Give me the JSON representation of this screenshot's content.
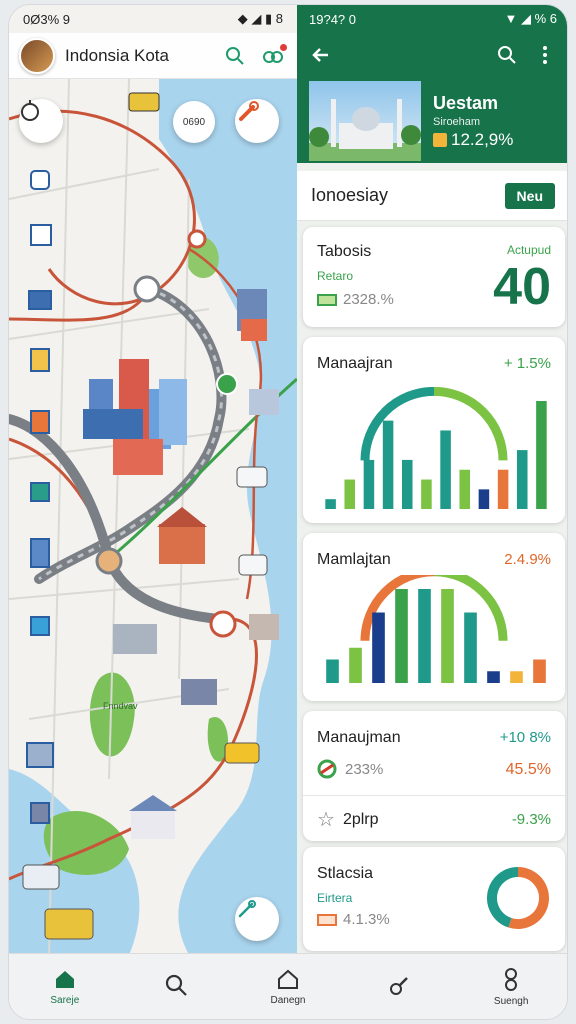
{
  "status_left": {
    "time": "0Ø3% 9",
    "icons": "◆ ◢ ▮ 8"
  },
  "status_right": {
    "time": "19?4? 0",
    "icons": "▼ ◢ % 6"
  },
  "app": {
    "title": "Indonsia Kota"
  },
  "map": {
    "button_label": "0690",
    "region_label": "Fnndvav"
  },
  "detail": {
    "hero_title": "Uestam",
    "hero_subtitle": "Siroeham",
    "hero_value": "12.2,9%",
    "section_label": "Ionoesiay",
    "new_button": "Neu"
  },
  "cards": {
    "c1": {
      "title": "Tabosis",
      "right_label": "Actupud",
      "sub_label": "Retaro",
      "value": "2328.%",
      "big": "40"
    },
    "c2": {
      "title": "Manaajran",
      "change": "+ 1.5%"
    },
    "c3": {
      "title": "Mamlajtan",
      "change": "2.4.9%"
    },
    "c4": {
      "title": "Manaujman",
      "change": "+10 8%",
      "row1_value": "233%",
      "row1_right": "45.5%",
      "row2_label": "2plrp",
      "row2_right": "-9.3%"
    },
    "c5": {
      "title": "Stlacsia",
      "sub_label": "Eirtera",
      "value": "4.1.3%"
    }
  },
  "chart_data": [
    {
      "type": "bar",
      "title": "Manaajran",
      "values": [
        1,
        3,
        5,
        9,
        5,
        3,
        8,
        4,
        2,
        4,
        6,
        11
      ],
      "colors": [
        "#1f9a8a",
        "#7cc243",
        "#1f9a8a",
        "#1f9a8a",
        "#1f9a8a",
        "#7cc243",
        "#1f9a8a",
        "#7cc243",
        "#1a3e8c",
        "#e8763a",
        "#1f9a8a",
        "#3aa24a"
      ]
    },
    {
      "type": "bar",
      "title": "Mamlajtan",
      "values": [
        2,
        3,
        6,
        8,
        8,
        8,
        6,
        1,
        1,
        2
      ],
      "colors": [
        "#1f9a8a",
        "#7cc243",
        "#1a3e8c",
        "#3aa24a",
        "#1f9a8a",
        "#7cc243",
        "#1f9a8a",
        "#1a3e8c",
        "#f2b43a",
        "#e8763a"
      ]
    },
    {
      "type": "pie",
      "title": "Stlacsia",
      "values": [
        55,
        45
      ],
      "colors": [
        "#e8763a",
        "#1f9a8a"
      ]
    }
  ],
  "nav": [
    {
      "label": "Sareje",
      "icon": "home-icon"
    },
    {
      "label": "",
      "icon": "search-icon"
    },
    {
      "label": "Danegn",
      "icon": "house-outline-icon"
    },
    {
      "label": "",
      "icon": "link-icon"
    },
    {
      "label": "Suengh",
      "icon": "person-icon"
    }
  ],
  "colors": {
    "primary": "#17734a",
    "accent_green": "#3aa24a",
    "accent_orange": "#e0662a",
    "teal": "#1f9a8a"
  }
}
